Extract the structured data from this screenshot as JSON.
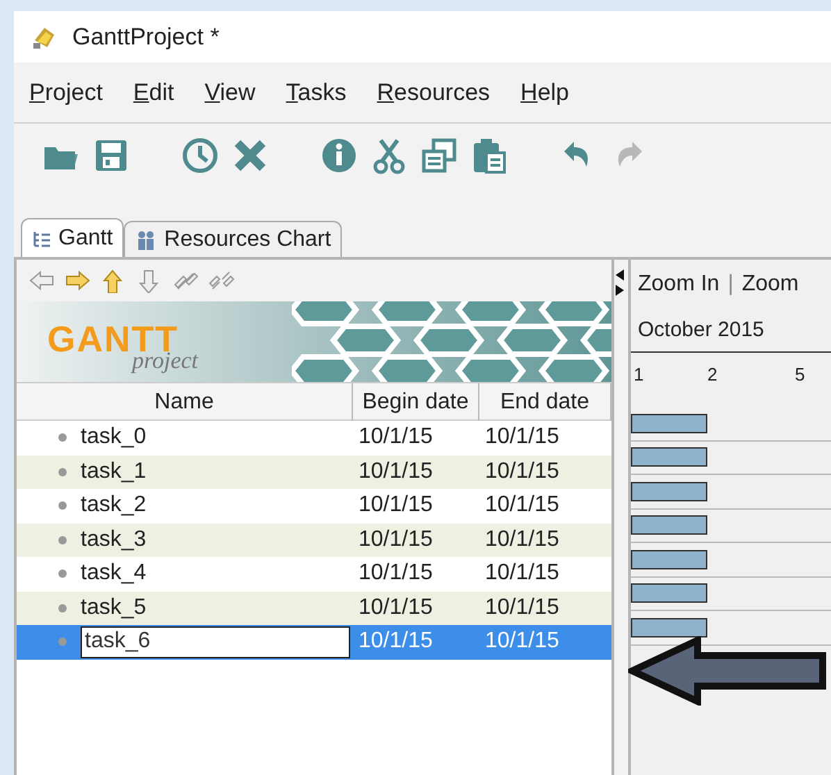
{
  "window": {
    "title": "GanttProject *"
  },
  "menu": [
    {
      "label": "Project"
    },
    {
      "label": "Edit"
    },
    {
      "label": "View"
    },
    {
      "label": "Tasks"
    },
    {
      "label": "Resources"
    },
    {
      "label": "Help"
    }
  ],
  "toolbar": [
    {
      "kind": "open",
      "disabled": false
    },
    {
      "kind": "save",
      "disabled": false
    },
    {
      "kind": "gap"
    },
    {
      "kind": "clock",
      "disabled": false
    },
    {
      "kind": "delete",
      "disabled": false
    },
    {
      "kind": "gap"
    },
    {
      "kind": "info",
      "disabled": false
    },
    {
      "kind": "cut",
      "disabled": false
    },
    {
      "kind": "copy",
      "disabled": false
    },
    {
      "kind": "paste",
      "disabled": false
    },
    {
      "kind": "gap"
    },
    {
      "kind": "undo",
      "disabled": false
    },
    {
      "kind": "redo",
      "disabled": true
    }
  ],
  "tabs": [
    {
      "label": "Gantt",
      "kind": "gantt",
      "selected": true
    },
    {
      "label": "Resources Chart",
      "kind": "people",
      "selected": false
    }
  ],
  "tree_toolbar": [
    {
      "kind": "left",
      "disabled": true
    },
    {
      "kind": "right",
      "disabled": false
    },
    {
      "kind": "up",
      "disabled": false
    },
    {
      "kind": "down",
      "disabled": true
    },
    {
      "kind": "link",
      "disabled": true
    },
    {
      "kind": "unlink",
      "disabled": true
    }
  ],
  "logo": {
    "title": "GANTT",
    "subtitle": "project"
  },
  "table": {
    "columns": [
      "Name",
      "Begin date",
      "End date"
    ],
    "rows": [
      {
        "name": "task_0",
        "begin": "10/1/15",
        "end": "10/1/15",
        "selected": false,
        "editing": false
      },
      {
        "name": "task_1",
        "begin": "10/1/15",
        "end": "10/1/15",
        "selected": false,
        "editing": false
      },
      {
        "name": "task_2",
        "begin": "10/1/15",
        "end": "10/1/15",
        "selected": false,
        "editing": false
      },
      {
        "name": "task_3",
        "begin": "10/1/15",
        "end": "10/1/15",
        "selected": false,
        "editing": false
      },
      {
        "name": "task_4",
        "begin": "10/1/15",
        "end": "10/1/15",
        "selected": false,
        "editing": false
      },
      {
        "name": "task_5",
        "begin": "10/1/15",
        "end": "10/1/15",
        "selected": false,
        "editing": false
      },
      {
        "name": "task_6",
        "begin": "10/1/15",
        "end": "10/1/15",
        "selected": true,
        "editing": true
      }
    ]
  },
  "chart": {
    "zoom_in": "Zoom In",
    "separator": "|",
    "zoom_out": "Zoom",
    "month": "October 2015",
    "ticks": [
      "1",
      "2",
      "5"
    ]
  }
}
